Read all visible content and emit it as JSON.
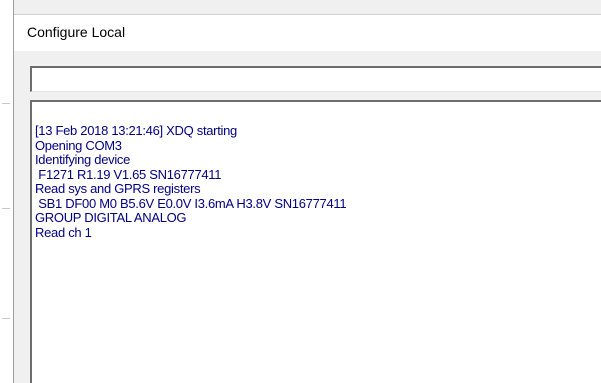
{
  "window": {
    "title": "Configure Local"
  },
  "command_input": {
    "value": ""
  },
  "log": {
    "lines": [
      "[13 Feb 2018 13:21:46] XDQ starting",
      "Opening COM3",
      "Identifying device",
      " F1271 R1.19 V1.65 SN16777411",
      "Read sys and GPRS registers",
      " SB1 DF00 M0 B5.6V E0.0V I3.6mA H3.8V SN16777411",
      "GROUP DIGITAL ANALOG",
      "Read ch 1"
    ],
    "text_color": "#000080"
  }
}
